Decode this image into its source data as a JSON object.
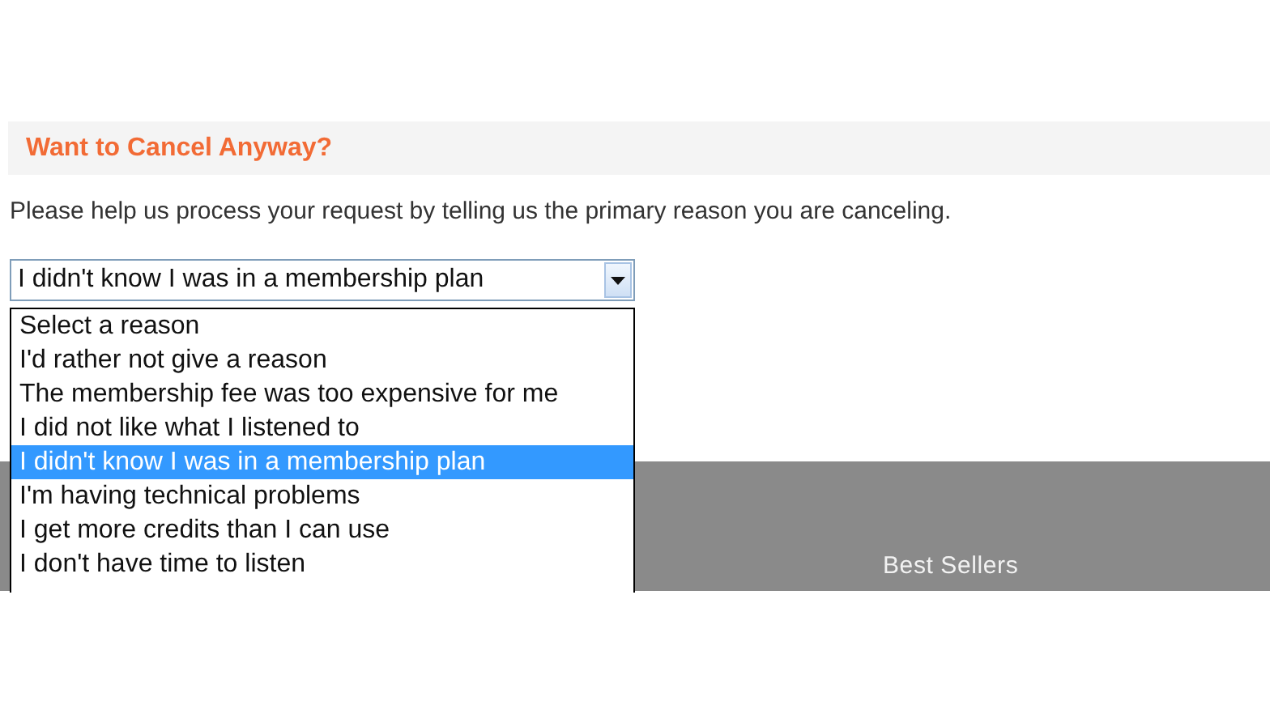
{
  "heading": "Want to Cancel Anyway?",
  "prompt": "Please help us process your request by telling us the primary reason you are canceling.",
  "select": {
    "value": "I didn't know I was in a membership plan",
    "expanded": true,
    "options": [
      {
        "label": "Select a reason",
        "selected": false
      },
      {
        "label": "I'd rather not give a reason",
        "selected": false
      },
      {
        "label": "The membership fee was too expensive for me",
        "selected": false
      },
      {
        "label": "I did not like what I listened to",
        "selected": false
      },
      {
        "label": "I didn't know I was in a membership plan",
        "selected": true
      },
      {
        "label": "I'm having technical problems",
        "selected": false
      },
      {
        "label": "I get more credits than I can use",
        "selected": false
      },
      {
        "label": "I don't have time to listen",
        "selected": false
      }
    ]
  },
  "footer": {
    "links": [
      "Best Sellers"
    ]
  }
}
